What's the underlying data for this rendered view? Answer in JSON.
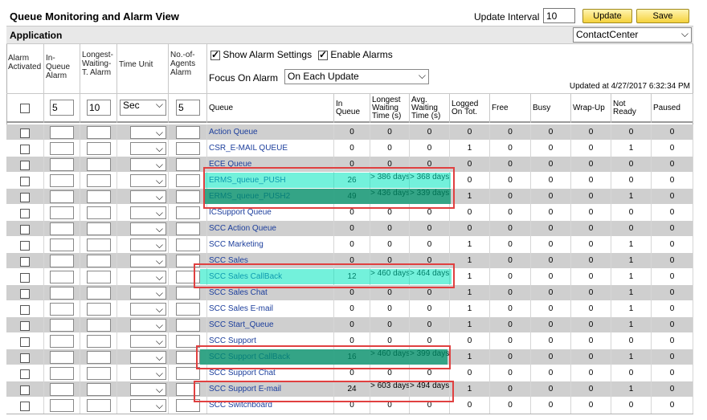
{
  "header": {
    "title": "Queue Monitoring and Alarm View",
    "update_interval_label": "Update Interval",
    "update_interval_value": "10",
    "update_button": "Update",
    "save_button": "Save"
  },
  "app_bar": {
    "label": "Application",
    "application_selected": "ContactCenter"
  },
  "alarm_columns": {
    "alarm_activated": "Alarm Activated",
    "in_queue_alarm": "In-Queue Alarm",
    "longest_waiting_alarm": "Longest-Waiting-T. Alarm",
    "time_unit": "Time Unit",
    "agents_alarm": "No.-of-Agents Alarm"
  },
  "settings": {
    "show_alarm_settings": "Show Alarm Settings",
    "enable_alarms": "Enable Alarms",
    "focus_label": "Focus On Alarm",
    "focus_value": "On Each Update",
    "updated_at": "Updated at 4/27/2017 6:32:34 PM"
  },
  "defaults": {
    "in_queue": "5",
    "longest": "10",
    "unit": "Sec",
    "agents": "5"
  },
  "columns": [
    "Queue",
    "In Queue",
    "Longest Waiting Time (s)",
    "Avg. Waiting Time (s)",
    "Logged On Tot.",
    "Free",
    "Busy",
    "Wrap-Up",
    "Not Ready",
    "Paused"
  ],
  "rows": [
    {
      "queue": "Action Queue",
      "in_queue": "0",
      "longest": "0",
      "avg": "0",
      "logged": "0",
      "free": "0",
      "busy": "0",
      "wrap": "0",
      "not_ready": "0",
      "paused": "0"
    },
    {
      "queue": "CSR_E-MAIL QUEUE",
      "in_queue": "0",
      "longest": "0",
      "avg": "0",
      "logged": "1",
      "free": "0",
      "busy": "0",
      "wrap": "0",
      "not_ready": "1",
      "paused": "0"
    },
    {
      "queue": "ECE Queue",
      "in_queue": "0",
      "longest": "0",
      "avg": "0",
      "logged": "0",
      "free": "0",
      "busy": "0",
      "wrap": "0",
      "not_ready": "0",
      "paused": "0"
    },
    {
      "queue": "ERMS_queue_PUSH",
      "in_queue": "26",
      "longest": "> 386 days",
      "avg": "> 368 days",
      "logged": "0",
      "free": "0",
      "busy": "0",
      "wrap": "0",
      "not_ready": "0",
      "paused": "0"
    },
    {
      "queue": "ERMS_queue_PUSH2",
      "in_queue": "49",
      "longest": "> 436 days",
      "avg": "> 339 days",
      "logged": "1",
      "free": "0",
      "busy": "0",
      "wrap": "0",
      "not_ready": "1",
      "paused": "0"
    },
    {
      "queue": "ICSupport Queue",
      "in_queue": "0",
      "longest": "0",
      "avg": "0",
      "logged": "0",
      "free": "0",
      "busy": "0",
      "wrap": "0",
      "not_ready": "0",
      "paused": "0"
    },
    {
      "queue": "SCC Action Queue",
      "in_queue": "0",
      "longest": "0",
      "avg": "0",
      "logged": "0",
      "free": "0",
      "busy": "0",
      "wrap": "0",
      "not_ready": "0",
      "paused": "0"
    },
    {
      "queue": "SCC Marketing",
      "in_queue": "0",
      "longest": "0",
      "avg": "0",
      "logged": "1",
      "free": "0",
      "busy": "0",
      "wrap": "0",
      "not_ready": "1",
      "paused": "0"
    },
    {
      "queue": "SCC Sales",
      "in_queue": "0",
      "longest": "0",
      "avg": "0",
      "logged": "1",
      "free": "0",
      "busy": "0",
      "wrap": "0",
      "not_ready": "1",
      "paused": "0"
    },
    {
      "queue": "SCC Sales CallBack",
      "in_queue": "12",
      "longest": "> 460 days",
      "avg": "> 464 days",
      "logged": "1",
      "free": "0",
      "busy": "0",
      "wrap": "0",
      "not_ready": "1",
      "paused": "0"
    },
    {
      "queue": "SCC Sales Chat",
      "in_queue": "0",
      "longest": "0",
      "avg": "0",
      "logged": "1",
      "free": "0",
      "busy": "0",
      "wrap": "0",
      "not_ready": "1",
      "paused": "0"
    },
    {
      "queue": "SCC Sales E-mail",
      "in_queue": "0",
      "longest": "0",
      "avg": "0",
      "logged": "1",
      "free": "0",
      "busy": "0",
      "wrap": "0",
      "not_ready": "1",
      "paused": "0"
    },
    {
      "queue": "SCC Start_Queue",
      "in_queue": "0",
      "longest": "0",
      "avg": "0",
      "logged": "1",
      "free": "0",
      "busy": "0",
      "wrap": "0",
      "not_ready": "1",
      "paused": "0"
    },
    {
      "queue": "SCC Support",
      "in_queue": "0",
      "longest": "0",
      "avg": "0",
      "logged": "0",
      "free": "0",
      "busy": "0",
      "wrap": "0",
      "not_ready": "0",
      "paused": "0"
    },
    {
      "queue": "SCC Support CallBack",
      "in_queue": "16",
      "longest": "> 460 days",
      "avg": "> 399 days",
      "logged": "1",
      "free": "0",
      "busy": "0",
      "wrap": "0",
      "not_ready": "1",
      "paused": "0"
    },
    {
      "queue": "SCC Support Chat",
      "in_queue": "0",
      "longest": "0",
      "avg": "0",
      "logged": "0",
      "free": "0",
      "busy": "0",
      "wrap": "0",
      "not_ready": "0",
      "paused": "0"
    },
    {
      "queue": "SCC Support E-mail",
      "in_queue": "24",
      "longest": "> 603 days",
      "avg": "> 494 days",
      "logged": "1",
      "free": "0",
      "busy": "0",
      "wrap": "0",
      "not_ready": "1",
      "paused": "0"
    },
    {
      "queue": "SCC Switchboard",
      "in_queue": "0",
      "longest": "0",
      "avg": "0",
      "logged": "0",
      "free": "0",
      "busy": "0",
      "wrap": "0",
      "not_ready": "0",
      "paused": "0"
    }
  ],
  "highlight_colors": {
    "teal": "#00e6be",
    "dark_teal": "#00966e",
    "red_box": "#e04040"
  }
}
